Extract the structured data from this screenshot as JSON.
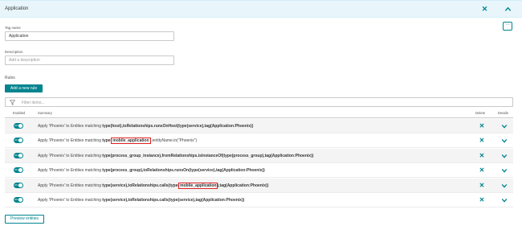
{
  "header": {
    "title": "Application"
  },
  "form": {
    "tag_name_label": "Tag name",
    "tag_name_value": "Application",
    "description_label": "Description",
    "description_placeholder": "Add a description"
  },
  "rules": {
    "label": "Rules",
    "add_button": "Add a new rule",
    "filter_placeholder": "Filter items...",
    "columns": {
      "enabled": "Enabled",
      "summary": "Summary",
      "delete": "Delete",
      "details": "Details"
    },
    "toggle_text": "ON",
    "items": [
      {
        "prefix": "Apply 'Phoenix' to Entities matching ",
        "parts": [
          {
            "text": "type(host),toRelationships.runsOnHost(type(service),tag(Application:Phoenix))",
            "bold": true
          }
        ]
      },
      {
        "prefix": "Apply 'Phoenix' to Entities matching ",
        "parts": [
          {
            "text": "type(",
            "bold": true
          },
          {
            "text": "mobile_application",
            "bold": true,
            "highlight": true
          },
          {
            "text": "),entityName.in(\"Phoenix\")",
            "bold": false
          }
        ]
      },
      {
        "prefix": "Apply 'Phoenix' to Entities matching ",
        "parts": [
          {
            "text": "type(process_group_instance),fromRelationships.isInstanceOf(type(process_group),tag(Application:Phoenix))",
            "bold": true
          }
        ]
      },
      {
        "prefix": "Apply 'Phoenix' to Entities matching ",
        "parts": [
          {
            "text": "type(process_group),toRelationships.runsOn(type(service),tag(Application:Phoenix))",
            "bold": true
          }
        ]
      },
      {
        "prefix": "Apply 'Phoenix' to Entities matching ",
        "parts": [
          {
            "text": "type(service),toRelationships.calls(type(",
            "bold": true
          },
          {
            "text": "mobile_application",
            "bold": true,
            "highlight": true
          },
          {
            "text": "),tag(Application:Phoenix))",
            "bold": true
          }
        ]
      },
      {
        "prefix": "Apply 'Phoenix' to Entities matching ",
        "parts": [
          {
            "text": "type(service),toRelationships.calls(type(service),tag(Application:Phoenix))",
            "bold": true
          }
        ]
      }
    ]
  },
  "footer": {
    "preview_button": "Preview entities"
  },
  "icons": {
    "close": "close-icon",
    "collapse": "chevron-up-icon",
    "more": "more-options-icon",
    "filter": "filter-icon",
    "delete": "delete-x-icon",
    "expand": "chevron-down-icon"
  },
  "colors": {
    "accent": "#00848f",
    "header_bg": "#e8f6fb",
    "highlight": "#e02020"
  }
}
